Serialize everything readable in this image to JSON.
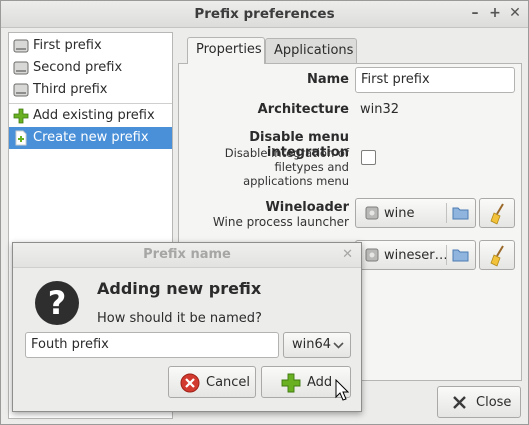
{
  "window": {
    "title": "Prefix preferences"
  },
  "prefix_list": {
    "items": [
      {
        "label": "First prefix"
      },
      {
        "label": "Second prefix"
      },
      {
        "label": "Third prefix"
      }
    ],
    "actions": [
      {
        "label": "Add existing prefix"
      },
      {
        "label": "Create new prefix"
      }
    ],
    "selected": "Create new prefix"
  },
  "tabs": [
    {
      "label": "Properties",
      "active": true
    },
    {
      "label": "Applications",
      "active": false
    }
  ],
  "properties": {
    "name_label": "Name",
    "name_value": "First prefix",
    "arch_label": "Architecture",
    "arch_value": "win32",
    "menu_label": "Disable menu integration",
    "menu_sub": "Disable integration of filetypes and applications menu",
    "menu_checked": false,
    "wineloader_label": "Wineloader",
    "wineloader_sub": "Wine process launcher",
    "wineloader_value": "wine",
    "wineserver_value": "wineser…"
  },
  "close_button": "Close",
  "dialog": {
    "title": "Prefix name",
    "heading": "Adding new prefix",
    "prompt": "How should it be named?",
    "input_value": "Fouth prefix",
    "arch_selected": "win64",
    "cancel_label": "Cancel",
    "add_label": "Add"
  },
  "colors": {
    "selection": "#4a90d9",
    "add_green": "#6ab023",
    "cancel_red": "#d33a2f"
  }
}
